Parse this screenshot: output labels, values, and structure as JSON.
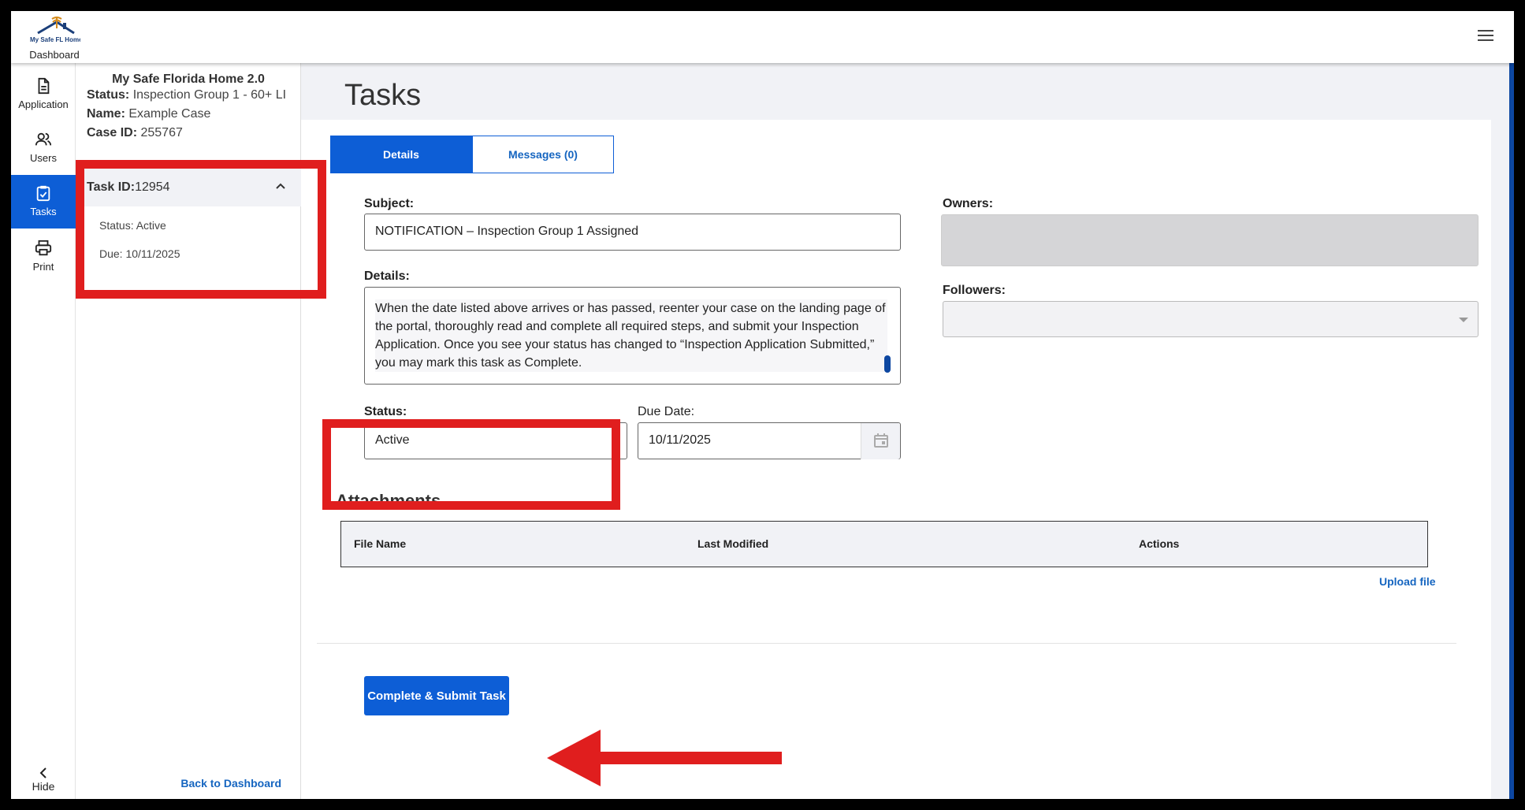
{
  "topbar": {
    "logo_text": "My Safe FL Home",
    "dashboard_label": "Dashboard"
  },
  "nav": {
    "items": [
      {
        "label": "Application",
        "icon": "document-icon"
      },
      {
        "label": "Users",
        "icon": "users-icon"
      },
      {
        "label": "Tasks",
        "icon": "tasks-icon",
        "active": true
      },
      {
        "label": "Print",
        "icon": "printer-icon"
      }
    ],
    "hide_label": "Hide"
  },
  "case": {
    "title": "My Safe Florida Home 2.0",
    "status_label": "Status:",
    "status_value": "Inspection Group 1 - 60+ LI",
    "name_label": "Name:",
    "name_value": "Example Case",
    "caseid_label": "Case ID:",
    "caseid_value": "255767",
    "task": {
      "id_label": "Task ID:",
      "id_value": "12954",
      "status_line": "Status: Active",
      "due_line": "Due: 10/11/2025"
    },
    "back_link": "Back to Dashboard"
  },
  "main": {
    "title": "Tasks",
    "tabs": [
      {
        "label": "Details",
        "active": true
      },
      {
        "label": "Messages (0)",
        "active": false
      }
    ],
    "subject_label": "Subject:",
    "subject_value": "NOTIFICATION – Inspection Group 1 Assigned",
    "details_label": "Details:",
    "details_value": "When the date listed above arrives or has passed, reenter your case on the landing page of the portal, thoroughly read and complete all required steps, and submit your Inspection Application. Once you see your status has changed to “Inspection Application Submitted,” you may mark this task as Complete.",
    "owners_label": "Owners:",
    "followers_label": "Followers:",
    "status_label": "Status:",
    "status_value": "Active",
    "due_label": "Due Date:",
    "due_value": "10/11/2025",
    "attachments_title": "Attachments",
    "attachments_columns": [
      "File Name",
      "Last Modified",
      "Actions"
    ],
    "upload_label": "Upload file",
    "submit_label": "Complete & Submit Task"
  },
  "colors": {
    "primary": "#0d5ed6",
    "link": "#1565c0",
    "highlight": "#e01e1e"
  }
}
